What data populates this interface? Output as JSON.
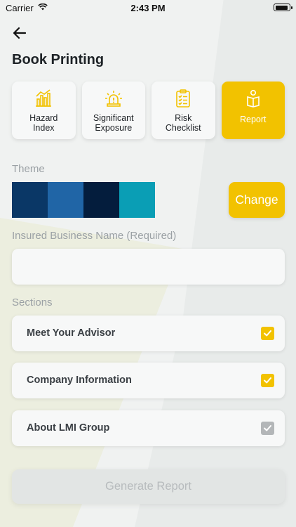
{
  "status_bar": {
    "carrier": "Carrier",
    "time": "2:43 PM"
  },
  "header": {
    "back_icon": "arrow-left-icon",
    "title": "Book Printing"
  },
  "tiles": [
    {
      "label": "Hazard\nIndex",
      "icon": "bar-chart-icon",
      "active": false
    },
    {
      "label": "Significant\nExposure",
      "icon": "alarm-light-icon",
      "active": false
    },
    {
      "label": "Risk\nChecklist",
      "icon": "clipboard-checklist-icon",
      "active": false
    },
    {
      "label": "Report",
      "icon": "report-reader-icon",
      "active": true
    }
  ],
  "theme": {
    "label": "Theme",
    "swatches": [
      "#0a3766",
      "#2065a6",
      "#041d3d",
      "#0a9eb5"
    ],
    "change_label": "Change"
  },
  "business_name": {
    "label": "Insured Business Name (Required)",
    "value": "",
    "placeholder": ""
  },
  "sections": {
    "label": "Sections",
    "items": [
      {
        "name": "Meet Your Advisor",
        "checked": true,
        "enabled": true
      },
      {
        "name": "Company Information",
        "checked": true,
        "enabled": true
      },
      {
        "name": "About LMI Group",
        "checked": true,
        "enabled": false
      }
    ]
  },
  "generate": {
    "label": "Generate Report",
    "enabled": false
  },
  "colors": {
    "accent": "#f2c200",
    "check_disabled": "#b3b6b8"
  }
}
